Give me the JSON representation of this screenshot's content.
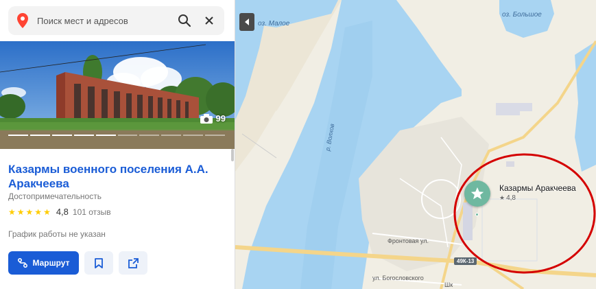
{
  "search": {
    "placeholder": "Поиск мест и адресов"
  },
  "place": {
    "photo_count": "99",
    "title": "Казармы военного поселения А.А. Аракчеева",
    "category": "Достопримечательность",
    "rating": "4,8",
    "reviews": "101 отзыв",
    "hours": "График работы не указан",
    "route_label": "Маршрут"
  },
  "map": {
    "lake_small": "оз. Малое",
    "lake_big": "оз. Большое",
    "river": "р. Волхов",
    "street_front": "Фронтовая ул.",
    "street_bogoslovsky": "ул. Богословского",
    "street_partial": "Шк",
    "road_code": "49К-13",
    "pin_title": "Казармы Аракчеева",
    "pin_rating": "4,8"
  },
  "colors": {
    "accent": "#1a5cd6",
    "water": "#a8d4f2",
    "pin": "#6fb8a0",
    "annotation": "#d40000",
    "star": "#ffcc00"
  }
}
